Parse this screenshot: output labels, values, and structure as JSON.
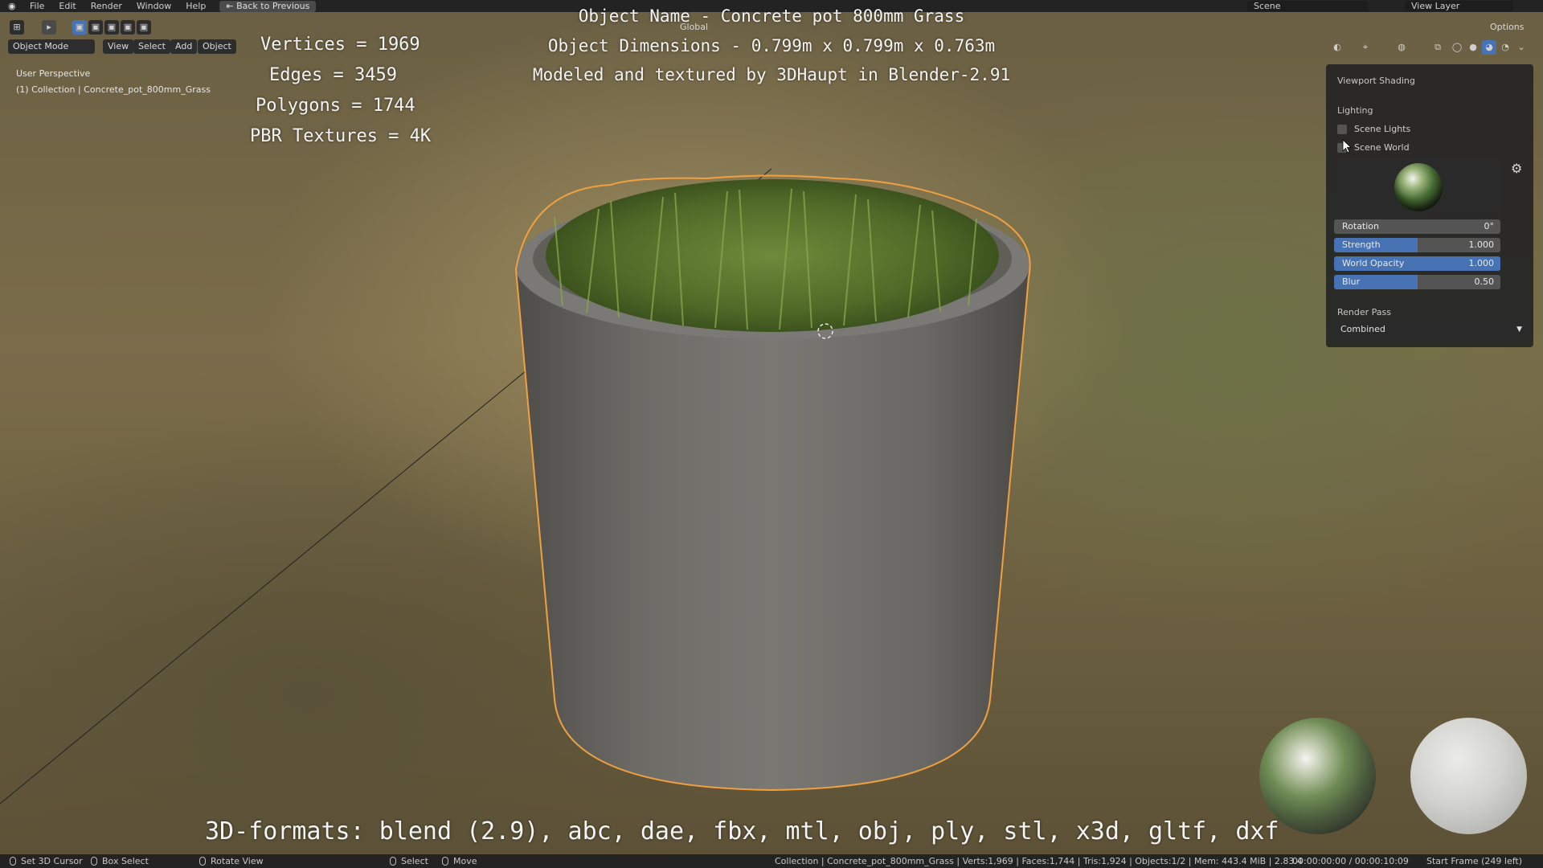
{
  "topbar": {
    "menu": [
      "File",
      "Edit",
      "Render",
      "Window",
      "Help"
    ],
    "back_button": "Back to Previous",
    "scene": "Scene",
    "view_layer": "View Layer"
  },
  "header": {
    "mode": "Object Mode",
    "menus": [
      "View",
      "Select",
      "Add",
      "Object"
    ],
    "transform_orientation": "Global",
    "options": "Options"
  },
  "viewport_info": {
    "perspective": "User Perspective",
    "collection": "(1) Collection | Concrete_pot_800mm_Grass"
  },
  "overlay_stats": {
    "vertices": "Vertices = 1969",
    "edges": "Edges = 3459",
    "polygons": "Polygons = 1744",
    "textures": "PBR Textures = 4K"
  },
  "overlay_center": {
    "object_name": "Object Name - Concrete pot 800mm Grass",
    "dimensions": "Object Dimensions -  0.799m x 0.799m x 0.763m",
    "credit": "Modeled and textured by 3DHaupt in Blender-2.91"
  },
  "overlay_formats": "3D-formats: blend (2.9), abc, dae, fbx, mtl, obj, ply, stl, x3d, gltf, dxf",
  "shading_panel": {
    "title": "Viewport Shading",
    "lighting_label": "Lighting",
    "scene_lights": "Scene Lights",
    "scene_world": "Scene World",
    "rotation": {
      "label": "Rotation",
      "value": "0°",
      "fill": 0
    },
    "strength": {
      "label": "Strength",
      "value": "1.000",
      "fill": 0.5
    },
    "world_opacity": {
      "label": "World Opacity",
      "value": "1.000",
      "fill": 1.0
    },
    "blur": {
      "label": "Blur",
      "value": "0.50",
      "fill": 0.5
    },
    "render_pass_label": "Render Pass",
    "render_pass_value": "Combined"
  },
  "statusbar": {
    "set_cursor": "Set 3D Cursor",
    "box_select": "Box Select",
    "rotate_view": "Rotate View",
    "select": "Select",
    "move": "Move",
    "scene_stats": "Collection | Concrete_pot_800mm_Grass | Verts:1,969 | Faces:1,744 | Tris:1,924 | Objects:1/2 | Mem: 443.4 MiB | 2.83.4",
    "time": "00:00:00:00 / 00:00:10:09",
    "frame": "Start Frame (249 left)"
  },
  "colors": {
    "accent": "#4772b3",
    "selection_outline": "#f0a040",
    "panel_bg": "#252525"
  }
}
